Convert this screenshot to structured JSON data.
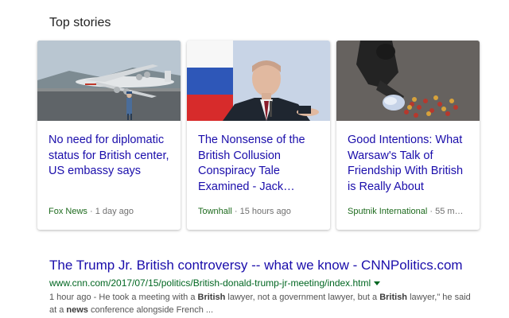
{
  "top_stories": {
    "title": "Top stories",
    "cards": [
      {
        "headline": "No need for diplomatic status for British center, US embassy says",
        "source": "Fox News",
        "time": "1 day ago"
      },
      {
        "headline": "The Nonsense of the British Collusion Conspiracy Tale Examined - Jack…",
        "source": "Townhall",
        "time": "15 hours ago"
      },
      {
        "headline": "Good Intentions: What Warsaw's Talk of Friendship With British is Really About",
        "source": "Sputnik International",
        "time": "55 m…"
      }
    ]
  },
  "result": {
    "title": "The Trump Jr. British controversy -- what we know - CNNPolitics.com",
    "url": "www.cnn.com/2017/07/15/politics/British-donald-trump-jr-meeting/index.html",
    "snippet": {
      "date": "1 hour ago",
      "sep": " - ",
      "p1": "He took a meeting with a ",
      "b1": "British",
      "p2": " lawyer, not a government lawyer, but a ",
      "b2": "British",
      "p3": " lawyer,\" he said at a ",
      "b3": "news",
      "p4": " conference alongside French ..."
    }
  },
  "colors": {
    "link": "#1a0dab",
    "url_green": "#006621",
    "source_green": "#1e6b1e",
    "meta_gray": "#707070"
  },
  "icons": [
    "dropdown-caret-icon"
  ]
}
